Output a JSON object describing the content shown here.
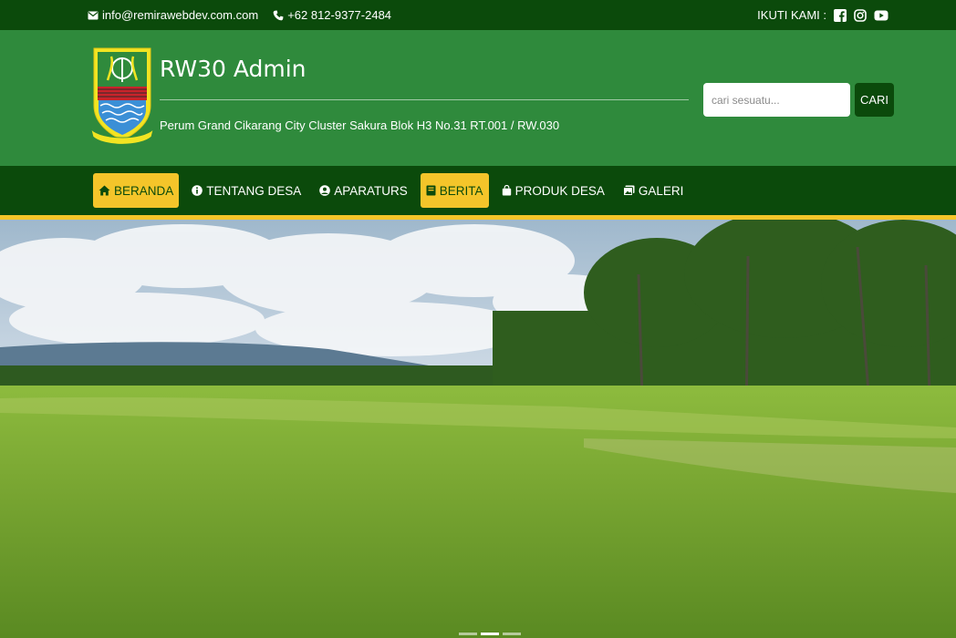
{
  "topbar": {
    "email": "info@remirawebdev.com.com",
    "phone": "+62 812-9377-2484",
    "follow_label": "IKUTI KAMI :",
    "social_icons": [
      "facebook-icon",
      "instagram-icon",
      "youtube-icon"
    ]
  },
  "header": {
    "title": "RW30 Admin",
    "address": "Perum Grand Cikarang City Cluster Sakura Blok H3 No.31 RT.001 / RW.030",
    "logo_icon": "regency-emblem-logo"
  },
  "search": {
    "placeholder": "cari sesuatu...",
    "button_label": "CARI"
  },
  "nav": {
    "items": [
      {
        "label": "BERANDA",
        "icon": "home-icon",
        "active": true
      },
      {
        "label": "TENTANG DESA",
        "icon": "info-icon",
        "active": false
      },
      {
        "label": "APARATURS",
        "icon": "user-circle-icon",
        "active": false
      },
      {
        "label": "BERITA",
        "icon": "book-icon",
        "active": true
      },
      {
        "label": "PRODUK DESA",
        "icon": "shopping-bag-icon",
        "active": false
      },
      {
        "label": "GALERI",
        "icon": "images-icon",
        "active": false
      }
    ]
  },
  "hero": {
    "image": "rice-field-landscape-photo",
    "slides": 3,
    "active_slide": 2
  },
  "colors": {
    "topbar": "#0b4a0b",
    "header": "#2f8a3c",
    "accent": "#f4c52a",
    "button": "#0b4a0b"
  }
}
